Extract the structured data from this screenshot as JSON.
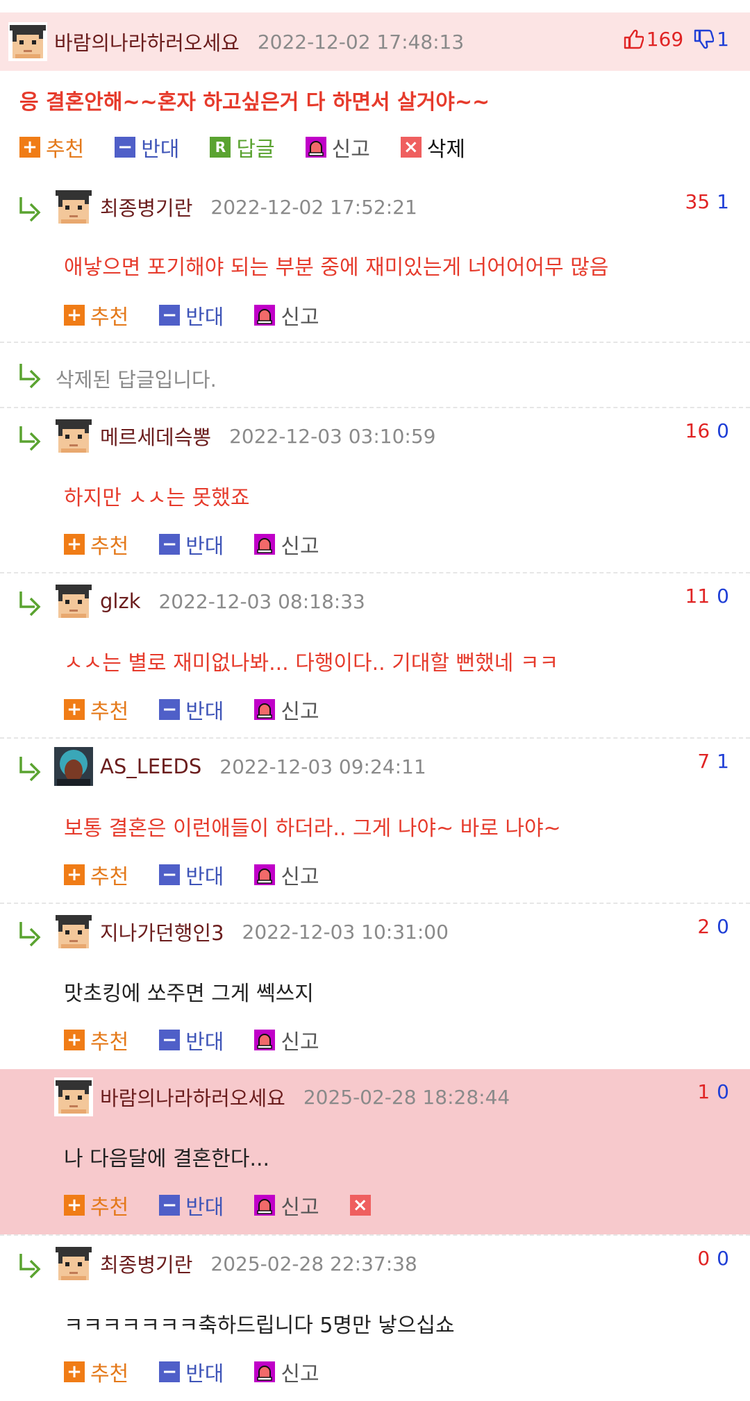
{
  "colors": {
    "main_bg": "#fce4e4",
    "highlight_bg": "#f7c9cc",
    "upvote": "#e02424",
    "downvote": "#1f3fd6",
    "nick": "#6b1d1d",
    "recommend": "#e4791a",
    "oppose": "#3f55b8",
    "reply": "#5aa330"
  },
  "actions": {
    "recommend": "추천",
    "oppose": "반대",
    "reply": "답글",
    "report": "신고",
    "delete": "삭제"
  },
  "main_comment": {
    "nick": "바람의나라하러오세요",
    "date": "2022-12-02 17:48:13",
    "up": "169",
    "down": "1",
    "text": "응 결혼안해~~혼자 하고싶은거 다 하면서 살거야~~"
  },
  "deleted_reply": {
    "text": "삭제된 답글입니다."
  },
  "replies": [
    {
      "nick": "최종병기란",
      "date": "2022-12-02 17:52:21",
      "up": "35",
      "down": "1",
      "text": "애낳으면 포기해야 되는 부분 중에 재미있는게 너어어어무 많음",
      "avatar": "pixel-avatar"
    },
    {
      "nick": "메르세데슥뽕",
      "date": "2022-12-03 03:10:59",
      "up": "16",
      "down": "0",
      "text": "하지만 ㅅㅅ는 못했죠",
      "avatar": "pixel-avatar"
    },
    {
      "nick": "glzk",
      "date": "2022-12-03 08:18:33",
      "up": "11",
      "down": "0",
      "text": "ㅅㅅ는 별로 재미없나봐... 다행이다.. 기대할 뻔했네 ㅋㅋ",
      "avatar": "pixel-avatar"
    },
    {
      "nick": "AS_LEEDS",
      "date": "2022-12-03 09:24:11",
      "up": "7",
      "down": "1",
      "text": "보통 결혼은 이런애들이 하더라.. 그게 나야~ 바로 나야~",
      "avatar": "photo-avatar"
    },
    {
      "nick": "지나가던행인3",
      "date": "2022-12-03 10:31:00",
      "up": "2",
      "down": "0",
      "text": "맛초킹에 쏘주면 그게 쎅쓰지",
      "avatar": "pixel-avatar"
    },
    {
      "nick": "바람의나라하러오세요",
      "date": "2025-02-28 18:28:44",
      "up": "1",
      "down": "0",
      "text": "나 다음달에 결혼한다...",
      "avatar": "pixel-avatar"
    },
    {
      "nick": "최종병기란",
      "date": "2025-02-28 22:37:38",
      "up": "0",
      "down": "0",
      "text": "ㅋㅋㅋㅋㅋㅋㅋ축하드립니다 5명만 낳으십쇼",
      "avatar": "pixel-avatar"
    }
  ]
}
